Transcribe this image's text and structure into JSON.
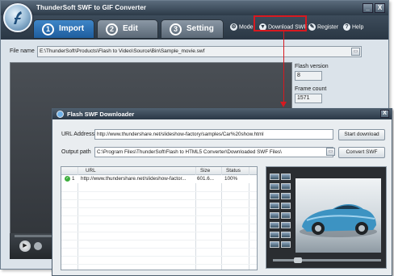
{
  "app": {
    "title": "ThunderSoft SWF to GIF Converter",
    "win_minimize": "_",
    "win_close": "X"
  },
  "tabs": [
    {
      "num": "1",
      "label": "Import",
      "active": true
    },
    {
      "num": "2",
      "label": "Edit",
      "active": false
    },
    {
      "num": "3",
      "label": "Setting",
      "active": false
    }
  ],
  "toolbar": {
    "mode": "Mode",
    "download_swf": "Download SWF",
    "register": "Register",
    "help": "Help"
  },
  "file": {
    "label": "File name",
    "value": "E:\\ThunderSoft\\Products\\Flash to Video\\Source\\Bin\\Sample_movie.swf"
  },
  "info": {
    "flash_version_label": "Flash version",
    "flash_version_value": "8",
    "frame_count_label": "Frame count",
    "frame_count_value": "1571"
  },
  "dialog": {
    "title": "Flash SWF Downloader",
    "url_label": "URL Address",
    "url_value": "http://www.thundershare.net/slideshow-factory/samples/Car%20show.html",
    "start_download": "Start download",
    "output_label": "Output path",
    "output_value": "C:\\Program Files\\ThunderSoft\\Flash to HTML5 Converter\\Downloaded SWF Files\\",
    "convert_swf": "Convert SWF",
    "columns": [
      "URL",
      "Size",
      "Status"
    ],
    "rows": [
      {
        "num": "1",
        "url": "http://www.thundershare.net/slideshow-factor...",
        "size": "601.6...",
        "status": "100%"
      }
    ]
  },
  "colors": {
    "highlight": "#d71920",
    "active_tab": "#2d74b8",
    "titlebar": "#3a4957"
  }
}
